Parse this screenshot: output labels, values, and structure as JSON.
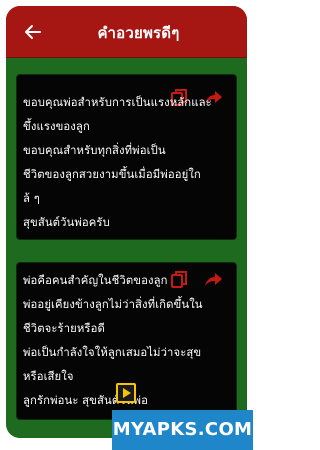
{
  "app": {
    "title": "คำอวยพรดีๆ",
    "accent_color": "#a61612",
    "background_color": "#1e6a1e"
  },
  "cards": [
    {
      "lines": [
        "ขอบคุณพ่อสำหรับการเป็นแรงหลักและ",
        "ขึ้งแรงของลูก",
        "ขอบคุณสำหรับทุกสิ่งที่พ่อเป็น",
        "ชีวิตของลูกสวยงามขึ้นเมื่อมีพ่ออยู่ใก",
        "ล้ ๆ",
        "สุขสันต์วันพ่อครับ"
      ]
    },
    {
      "lines": [
        "พ่อคือคนสำคัญในชีวิตของลูก",
        "พ่ออยู่เคียงข้างลูกไม่ว่าสิ่งที่เกิดขึ้นใน",
        "ชีวิตจะร้ายหรือดี",
        "พ่อเป็นกำลังใจให้ลูกเสมอไม่ว่าจะสุข",
        "หรือเสียใจ",
        "ลูกรักพ่อนะ สุขสันต์วันพ่อ"
      ]
    }
  ],
  "icons": {
    "back": "arrow-left-icon",
    "copy": "copy-icon",
    "share": "share-icon",
    "ad": "ad-play-icon"
  },
  "watermark": {
    "text": "MYAPKS.COM",
    "color": "#1e86c9"
  }
}
